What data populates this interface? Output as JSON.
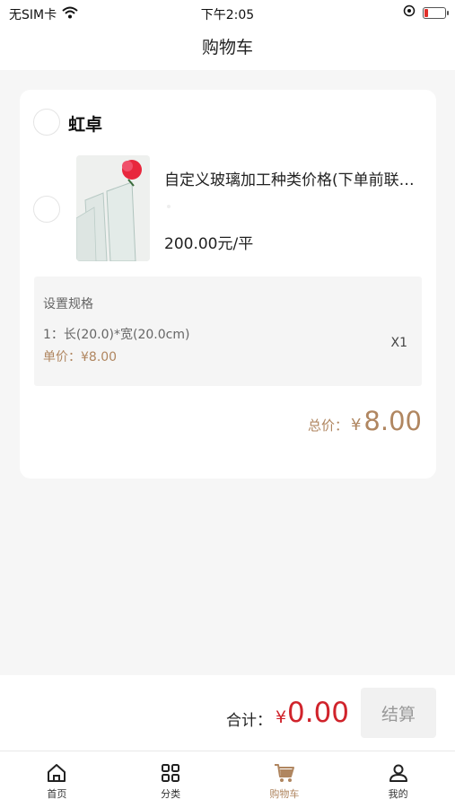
{
  "status_bar": {
    "carrier": "无SIM卡",
    "time": "下午2:05"
  },
  "nav": {
    "title": "购物车"
  },
  "shop": {
    "name": "虹卓"
  },
  "item": {
    "title": "自定义玻璃加工种类价格(下单前联系客服)",
    "price": "200.00元/平"
  },
  "spec": {
    "title": "设置规格",
    "line": "1：长(20.0)*宽(20.0cm)",
    "quantity": "X1",
    "unit_price": "单价：¥8.00"
  },
  "card_total": {
    "label": "总价：",
    "currency": "¥",
    "amount": "8.00"
  },
  "summary": {
    "label": "合计：",
    "currency": "¥",
    "amount": "0.00",
    "checkout_label": "结算"
  },
  "tabs": [
    {
      "label": "首页",
      "icon": "home-icon"
    },
    {
      "label": "分类",
      "icon": "grid-icon"
    },
    {
      "label": "购物车",
      "icon": "cart-icon",
      "active": true
    },
    {
      "label": "我的",
      "icon": "user-icon"
    }
  ],
  "colors": {
    "accent": "#b08660",
    "price_red": "#d0232b",
    "background": "#f6f6f6"
  }
}
